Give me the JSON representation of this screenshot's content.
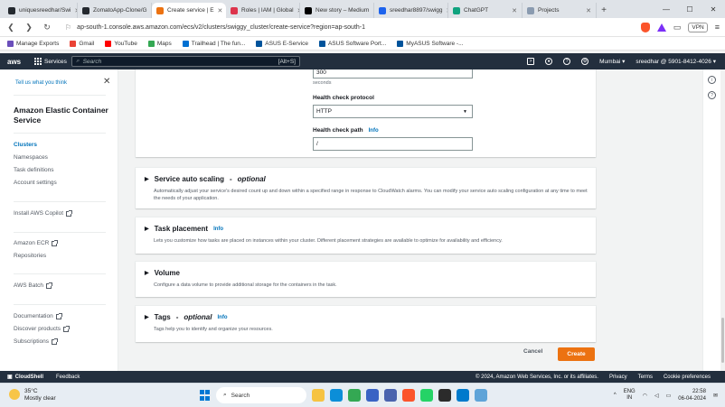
{
  "browser": {
    "tabs": [
      {
        "label": "uniquesreedhar/Swi",
        "color": "#24292f"
      },
      {
        "label": "ZomatoApp-Clone/G",
        "color": "#24292f"
      },
      {
        "label": "Create service | E",
        "color": "#ec7211",
        "active": true
      },
      {
        "label": "Roles | IAM | Global",
        "color": "#dd344c"
      },
      {
        "label": "New story – Medium",
        "color": "#000000"
      },
      {
        "label": "sreedhar8897/swigg",
        "color": "#1d63ed"
      },
      {
        "label": "ChatGPT",
        "color": "#10a37f"
      },
      {
        "label": "Projects",
        "color": "#8a9bb0"
      }
    ],
    "new_tab": "+",
    "url": "ap-south-1.console.aws.amazon.com/ecs/v2/clusters/swiggy_cluster/create-service?region=ap-south-1",
    "vpn_label": "VPN",
    "bookmarks": [
      {
        "label": "Manage Exports",
        "color": "#6b4fbb"
      },
      {
        "label": "Gmail",
        "color": "#ea4335"
      },
      {
        "label": "YouTube",
        "color": "#ff0000"
      },
      {
        "label": "Maps",
        "color": "#34a853"
      },
      {
        "label": "Trailhead | The fun...",
        "color": "#0070d2"
      },
      {
        "label": "ASUS E-Service",
        "color": "#00539b"
      },
      {
        "label": "ASUS Software Port...",
        "color": "#00539b"
      },
      {
        "label": "MyASUS Software -...",
        "color": "#00539b"
      }
    ]
  },
  "aws_nav": {
    "logo": "aws",
    "services": "Services",
    "search_placeholder": "Search",
    "search_shortcut": "[Alt+S]",
    "region": "Mumbai",
    "account": "sreedhar @ 5901-8412-4026"
  },
  "sidebar": {
    "tell_link": "Tell us what you think",
    "title": "Amazon Elastic Container Service",
    "items": [
      {
        "label": "Clusters",
        "active": true
      },
      {
        "label": "Namespaces"
      },
      {
        "label": "Task definitions"
      },
      {
        "label": "Account settings"
      }
    ],
    "group2": [
      {
        "label": "Install AWS Copilot",
        "external": true
      }
    ],
    "group3": [
      {
        "label": "Amazon ECR",
        "external": true
      },
      {
        "label": "Repositories"
      }
    ],
    "group4": [
      {
        "label": "AWS Batch",
        "external": true
      }
    ],
    "group5": [
      {
        "label": "Documentation",
        "external": true
      },
      {
        "label": "Discover products",
        "external": true
      },
      {
        "label": "Subscriptions",
        "external": true
      }
    ]
  },
  "health_check": {
    "interval_value": "300",
    "interval_unit": "seconds",
    "protocol_label": "Health check protocol",
    "protocol_value": "HTTP",
    "path_label": "Health check path",
    "path_info": "Info",
    "path_value": "/"
  },
  "sections": [
    {
      "title": "Service auto scaling",
      "suffix": "optional",
      "info": "",
      "desc": "Automatically adjust your service's desired count up and down within a specified range in response to CloudWatch alarms. You can modify your service auto scaling configuration at any time to meet the needs of your application."
    },
    {
      "title": "Task placement",
      "suffix": "",
      "info": "Info",
      "desc": "Lets you customize how tasks are placed on instances within your cluster. Different placement strategies are available to optimize for availability and efficiency."
    },
    {
      "title": "Volume",
      "suffix": "",
      "info": "",
      "desc": "Configure a data volume to provide additional storage for the containers in the task."
    },
    {
      "title": "Tags",
      "suffix": "optional",
      "info": "Info",
      "desc": "Tags help you to identify and organize your resources."
    }
  ],
  "actions": {
    "cancel": "Cancel",
    "create": "Create"
  },
  "footer": {
    "cloudshell": "CloudShell",
    "feedback": "Feedback",
    "copyright": "© 2024, Amazon Web Services, Inc. or its affiliates.",
    "privacy": "Privacy",
    "terms": "Terms",
    "cookies": "Cookie preferences"
  },
  "taskbar": {
    "temp": "35°C",
    "condition": "Mostly clear",
    "search": "Search",
    "lang1": "ENG",
    "lang2": "IN",
    "time": "22:58",
    "date": "06-04-2024",
    "apps": [
      {
        "name": "file-explorer-icon",
        "color": "#f6c342"
      },
      {
        "name": "edge-icon",
        "color": "#0c8ed8"
      },
      {
        "name": "chrome-icon",
        "color": "#34a853"
      },
      {
        "name": "store-icon",
        "color": "#3a63c4"
      },
      {
        "name": "affinity-icon",
        "color": "#4a63ae"
      },
      {
        "name": "brave-icon",
        "color": "#fb542b"
      },
      {
        "name": "whatsapp-icon",
        "color": "#25d366"
      },
      {
        "name": "terminal-icon",
        "color": "#2b2b2b"
      },
      {
        "name": "vscode-icon",
        "color": "#007acc"
      },
      {
        "name": "notepad-icon",
        "color": "#5fa4d8"
      }
    ]
  }
}
